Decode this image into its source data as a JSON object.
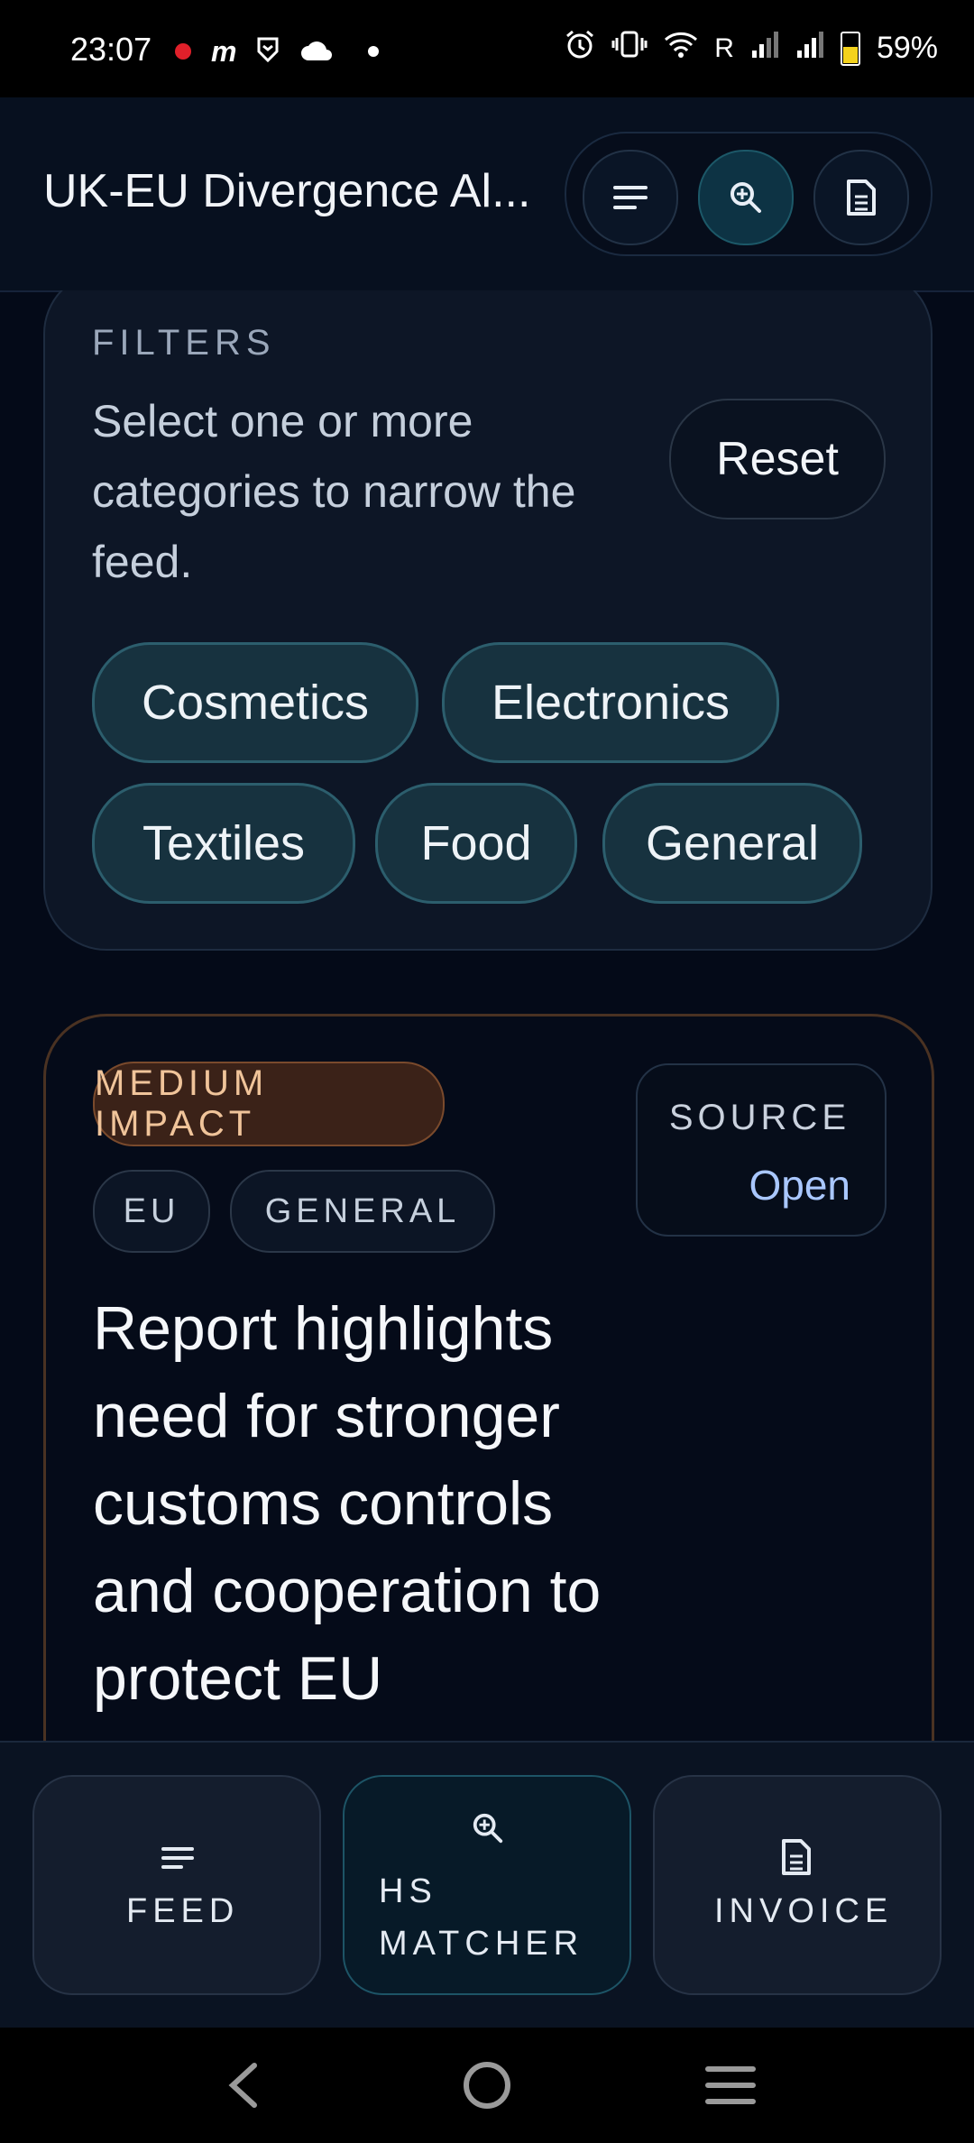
{
  "status_bar": {
    "time": "23:07",
    "carrier_flag": "R",
    "battery": "59%",
    "icons": [
      "notification-dot-icon",
      "m-app-icon",
      "shield-app-icon",
      "cloud-icon",
      "more-dot-icon",
      "alarm-icon",
      "vibrate-icon",
      "wifi-icon",
      "signal-icon",
      "signal-icon",
      "battery-icon"
    ]
  },
  "app_bar": {
    "title": "UK-EU Divergence Al...",
    "buttons": [
      {
        "icon": "feed-lines-icon",
        "active": false
      },
      {
        "icon": "zoom-search-icon",
        "active": true
      },
      {
        "icon": "document-icon",
        "active": false
      }
    ]
  },
  "filters": {
    "label": "FILTERS",
    "description": "Select one or more categories to narrow the feed.",
    "reset_label": "Reset",
    "chips": [
      "Cosmetics",
      "Electronics",
      "Textiles",
      "Food",
      "General"
    ]
  },
  "alert": {
    "impact": "MEDIUM IMPACT",
    "tags": [
      "EU",
      "GENERAL"
    ],
    "source_label": "SOURCE",
    "source_link": "Open",
    "headline": "Report highlights need for stronger customs controls and cooperation to protect EU",
    "colors": {
      "impact_bg": "#3b2218",
      "impact_text": "#f0c49a"
    }
  },
  "bottom_nav": {
    "items": [
      {
        "label": "FEED",
        "icon": "feed-lines-icon",
        "active": false
      },
      {
        "label": "HS MATCHER",
        "icon": "zoom-search-icon",
        "active": true
      },
      {
        "label": "INVOICE",
        "icon": "document-icon",
        "active": false
      }
    ]
  },
  "accent_color": "#2c5e6d"
}
